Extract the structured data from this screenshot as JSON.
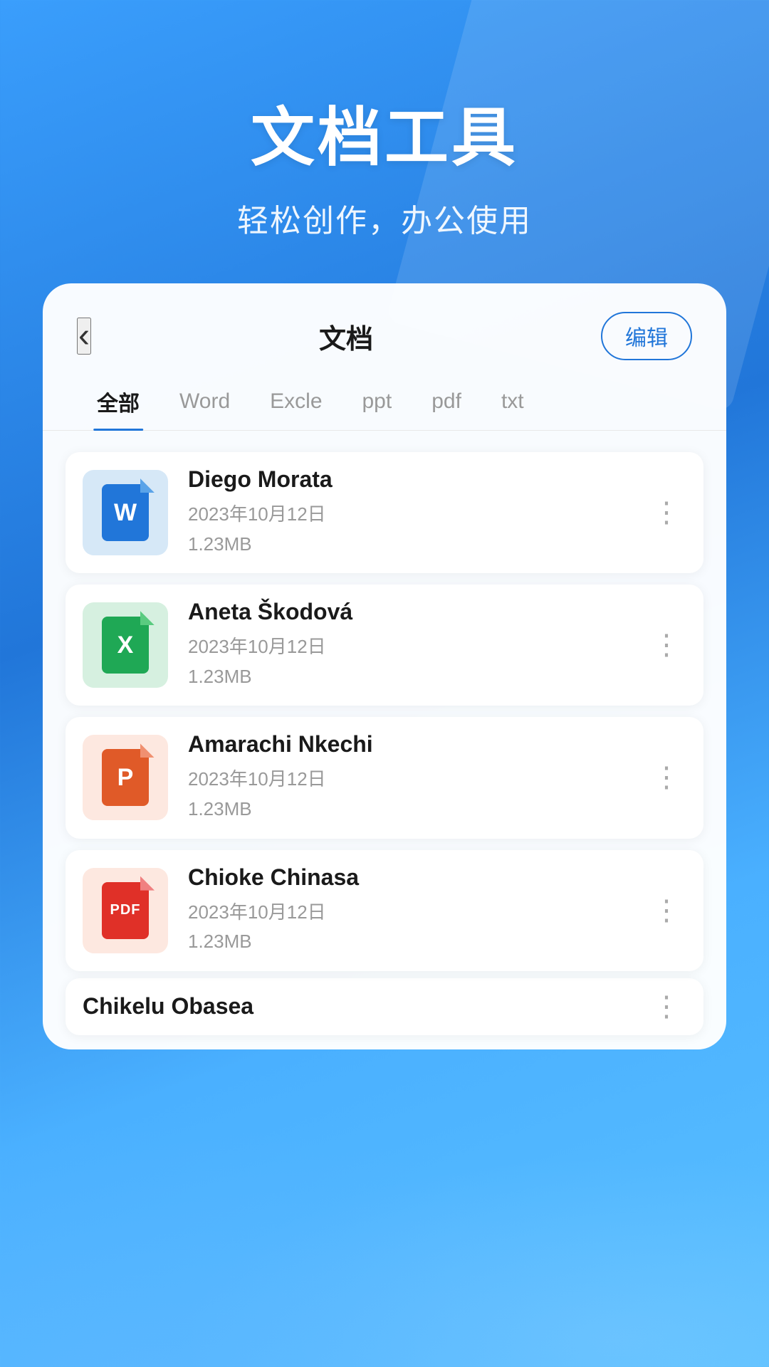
{
  "hero": {
    "title": "文档工具",
    "subtitle": "轻松创作，办公使用"
  },
  "card": {
    "back_label": "‹",
    "title": "文档",
    "edit_label": "编辑"
  },
  "tabs": [
    {
      "label": "全部",
      "active": true
    },
    {
      "label": "Word",
      "active": false
    },
    {
      "label": "Excle",
      "active": false
    },
    {
      "label": "ppt",
      "active": false
    },
    {
      "label": "pdf",
      "active": false
    },
    {
      "label": "txt",
      "active": false
    }
  ],
  "files": [
    {
      "name": "Diego Morata",
      "date": "2023年10月12日",
      "size": "1.23MB",
      "type": "word",
      "icon_letter": "W"
    },
    {
      "name": "Aneta Škodová",
      "date": "2023年10月12日",
      "size": "1.23MB",
      "type": "excel",
      "icon_letter": "X"
    },
    {
      "name": "Amarachi Nkechi",
      "date": "2023年10月12日",
      "size": "1.23MB",
      "type": "ppt",
      "icon_letter": "P"
    },
    {
      "name": "Chioke Chinasa",
      "date": "2023年10月12日",
      "size": "1.23MB",
      "type": "pdf",
      "icon_letter": "PDF"
    }
  ],
  "partial_file": {
    "name": "Chikelu Obasea"
  },
  "more_icon": "⋮"
}
